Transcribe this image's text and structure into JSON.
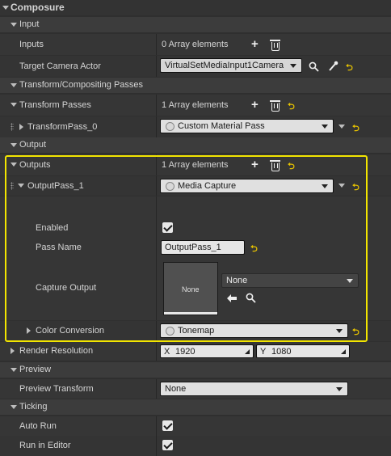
{
  "title": "Composure",
  "sections": {
    "input": "Input",
    "transform": "Transform/Compositing Passes",
    "output": "Output",
    "preview": "Preview",
    "ticking": "Ticking"
  },
  "input": {
    "inputs_label": "Inputs",
    "inputs_value": "0 Array elements",
    "camera_label": "Target Camera Actor",
    "camera_value": "VirtualSetMediaInput1Camera"
  },
  "transform": {
    "passes_label": "Transform Passes",
    "passes_value": "1 Array elements",
    "pass0_label": "TransformPass_0",
    "pass0_value": "Custom Material Pass"
  },
  "output": {
    "outputs_label": "Outputs",
    "outputs_value": "1 Array elements",
    "pass1_label": "OutputPass_1",
    "pass1_value": "Media Capture",
    "enabled_label": "Enabled",
    "enabled_checked": true,
    "passname_label": "Pass Name",
    "passname_value": "OutputPass_1",
    "capture_label": "Capture Output",
    "capture_thumb": "None",
    "capture_value": "None",
    "color_label": "Color Conversion",
    "color_value": "Tonemap",
    "render_label": "Render Resolution",
    "res_x_axis": "X",
    "res_x": "1920",
    "res_y_axis": "Y",
    "res_y": "1080"
  },
  "preview": {
    "transform_label": "Preview Transform",
    "transform_value": "None"
  },
  "ticking": {
    "autorun_label": "Auto Run",
    "autorun_checked": true,
    "editor_label": "Run in Editor",
    "editor_checked": true
  },
  "icons": {
    "reset": "⮌",
    "plus": "+"
  },
  "colors": {
    "highlight": "#f2e500",
    "reset": "#e5c100"
  }
}
